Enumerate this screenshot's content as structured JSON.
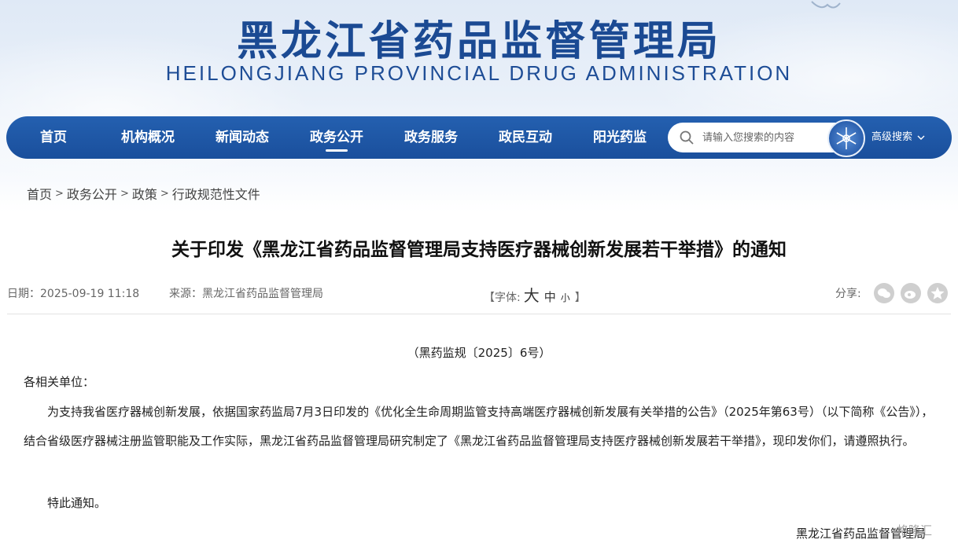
{
  "header": {
    "title": "黑龙江省药品监督管理局",
    "subtitle": "HEILONGJIANG PROVINCIAL DRUG ADMINISTRATION"
  },
  "nav": {
    "items": [
      {
        "label": "首页"
      },
      {
        "label": "机构概况"
      },
      {
        "label": "新闻动态"
      },
      {
        "label": "政务公开"
      },
      {
        "label": "政务服务"
      },
      {
        "label": "政民互动"
      },
      {
        "label": "阳光药监"
      }
    ],
    "active": "政务公开",
    "search_placeholder": "请输入您搜索的内容",
    "advanced_search": "高级搜索"
  },
  "breadcrumb": [
    "首页",
    "政务公开",
    "政策",
    "行政规范性文件"
  ],
  "article": {
    "title": "关于印发《黑龙江省药品监督管理局支持医疗器械创新发展若干举措》的通知",
    "date": "日期：2025-09-19 11:18",
    "source": "来源：黑龙江省药品监督管理局",
    "font_label": "【字体:",
    "font_big": "大",
    "font_mid": "中",
    "font_small": "小",
    "font_close": "】",
    "share_label": "分享:",
    "doc_number": "（黑药监规〔2025〕6号）",
    "salutation": "各相关单位：",
    "body": "　　为支持我省医疗器械创新发展，依据国家药监局7月3日印发的《优化全生命周期监管支持高端医疗器械创新发展有关举措的公告》（2025年第63号）（以下简称《公告》），结合省级医疗器械注册监管职能及工作实际，黑龙江省药品监督管理局研究制定了《黑龙江省药品监督管理局支持医疗器械创新发展若干举措》，现印发你们，请遵照执行。",
    "closing": "　　特此通知。",
    "signature": "黑龙江省药品监督管理局"
  },
  "watermark": "格隆汇",
  "share_icons": [
    "wechat-icon",
    "weibo-icon",
    "favorite-icon"
  ]
}
